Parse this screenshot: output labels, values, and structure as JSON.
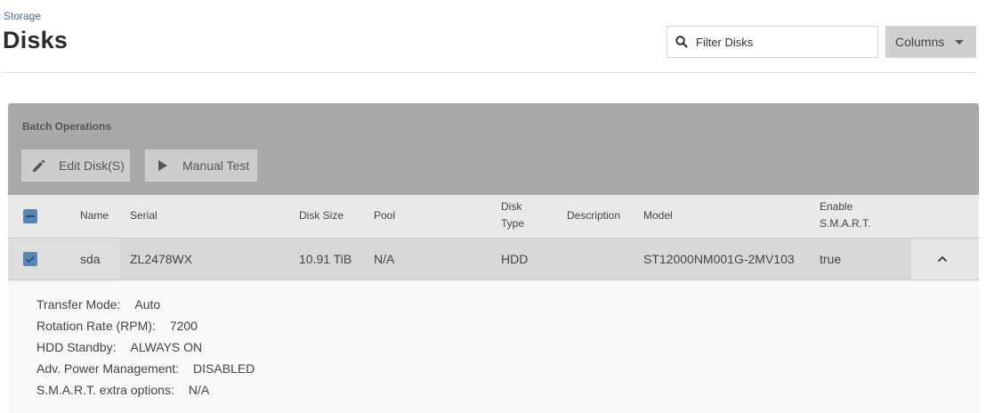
{
  "breadcrumb": "Storage",
  "title": "Disks",
  "filter": {
    "placeholder": "Filter Disks",
    "icon": "search-icon"
  },
  "columns_button": {
    "label": "Columns",
    "icon": "caret-down-icon"
  },
  "batch": {
    "title": "Batch Operations",
    "edit_label": "Edit Disk(S)",
    "edit_icon": "pencil-icon",
    "test_label": "Manual Test",
    "test_icon": "play-icon"
  },
  "table": {
    "headers": {
      "name": "Name",
      "serial": "Serial",
      "size": "Disk Size",
      "pool": "Pool",
      "type_line1": "Disk",
      "type_line2": "Type",
      "description": "Description",
      "model": "Model",
      "smart_line1": "Enable",
      "smart_line2": "S.M.A.R.T."
    },
    "row": {
      "checked": true,
      "name": "sda",
      "serial": "ZL2478WX",
      "size": "10.91 TiB",
      "pool": "N/A",
      "type": "HDD",
      "description": "",
      "model": "ST12000NM001G-2MV103",
      "smart": "true",
      "expand_icon": "chevron-up-icon"
    }
  },
  "details": [
    {
      "label": "Transfer Mode:",
      "value": "Auto"
    },
    {
      "label": "Rotation Rate (RPM):",
      "value": "7200"
    },
    {
      "label": "HDD Standby:",
      "value": "ALWAYS ON"
    },
    {
      "label": "Adv. Power Management:",
      "value": "DISABLED"
    },
    {
      "label": "S.M.A.R.T. extra options:",
      "value": "N/A"
    }
  ],
  "colors": {
    "accent": "#5a85b8",
    "batch_bg": "#a9a9a9",
    "row_selected": "#d8d8d8"
  }
}
